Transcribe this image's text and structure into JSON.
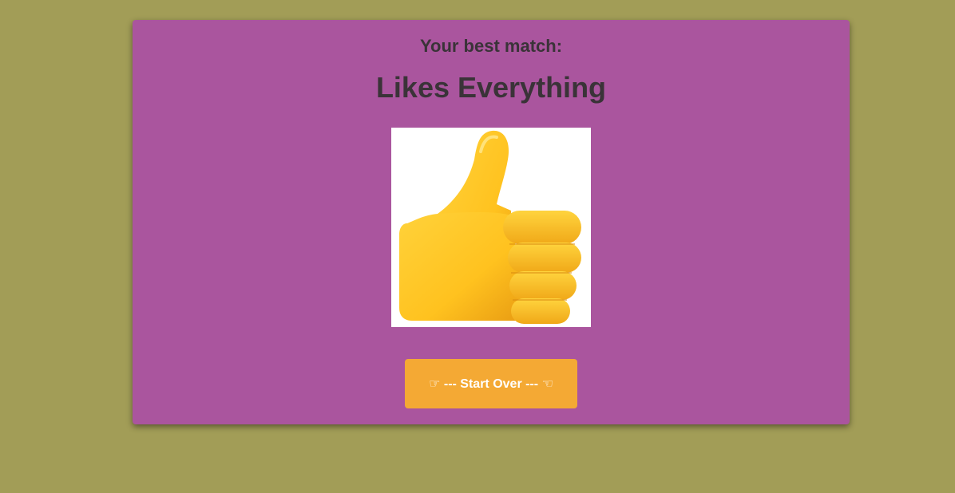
{
  "result": {
    "subtitle": "Your best match:",
    "title": "Likes Everything",
    "image": "thumbs-up-emoji"
  },
  "actions": {
    "start_over_label": "--- Start Over ---",
    "left_icon": "pointing-right-hand-icon",
    "right_icon": "pointing-left-hand-icon"
  },
  "colors": {
    "background": "#a29d57",
    "card": "#aa559e",
    "text": "#3a3338",
    "button": "#f4a934",
    "button_text": "#ffffff"
  }
}
